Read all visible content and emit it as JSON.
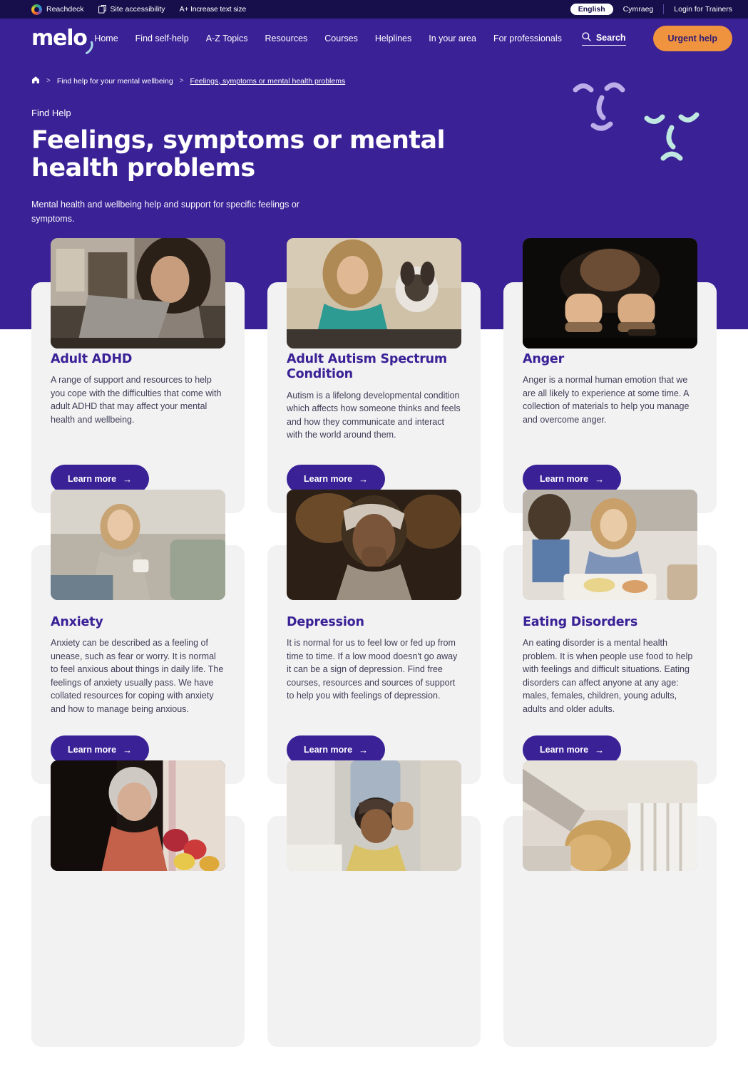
{
  "utility_bar": {
    "reachdeck_label": "Reachdeck",
    "site_accessibility_label": "Site accessibility",
    "increase_text_label": "A+ Increase text size",
    "lang_active": "English",
    "lang_alt": "Cymraeg",
    "login_label": "Login for Trainers",
    "background_color": "#160F4B"
  },
  "navbar": {
    "logo_text": "melo",
    "links": [
      {
        "label": "Home"
      },
      {
        "label": "Find self-help"
      },
      {
        "label": "A-Z Topics"
      },
      {
        "label": "Resources"
      },
      {
        "label": "Courses"
      },
      {
        "label": "Helplines"
      },
      {
        "label": "In your area"
      },
      {
        "label": "For professionals"
      }
    ],
    "search_label": "Search",
    "urgent_help_label": "Urgent help",
    "background_color": "#3A2196",
    "urgent_color": "#F0933F"
  },
  "breadcrumb": {
    "home_title": "Home",
    "items": [
      {
        "label": "Find help for your mental wellbeing",
        "current": false
      },
      {
        "label": "Feelings, symptoms or mental health problems",
        "current": true
      }
    ],
    "separator": ">"
  },
  "hero": {
    "eyebrow": "Find Help",
    "title": "Feelings, symptoms or mental health problems",
    "subtitle": "Mental health and wellbeing help and support for specific feelings or symptoms.",
    "face_colors": {
      "smiling": "#BCAEE8",
      "frowning": "#BFE8E0"
    }
  },
  "cards": [
    {
      "title": "Adult ADHD",
      "description": "A range of support and resources to help you cope with the difficulties that come with adult ADHD that may affect your mental health and wellbeing.",
      "button_label": "Learn more",
      "image_alt": "Woman with curly hair looking stressed at a laptop in a library"
    },
    {
      "title": "Adult Autism Spectrum Condition",
      "description": "Autism is a lifelong developmental condition which affects how someone thinks and feels and how they communicate and interact with the world around them.",
      "button_label": "Learn more",
      "image_alt": "Woman at a desk holding her head with a small dog beside her"
    },
    {
      "title": "Anger",
      "description": "Anger is a normal human emotion that we are all likely to experience at some time. A collection of materials to help you manage and overcome anger.",
      "button_label": "Learn more",
      "image_alt": "Two clenched fists against a dark background"
    },
    {
      "title": "Anxiety",
      "description": "Anxiety can be described as a feeling of unease, such as fear or worry. It is normal to feel anxious about things in daily life. The feelings of anxiety usually pass. We have collated resources for coping with anxiety and how to manage being anxious.",
      "button_label": "Learn more",
      "image_alt": "Woman with glasses sitting on a sofa holding a mug"
    },
    {
      "title": "Depression",
      "description": "It is normal for us to feel low or fed up from time to time. If a low mood doesn't go away it can be a sign of depression. Find free courses, resources and sources of support to help you with feelings of depression.",
      "button_label": "Learn more",
      "image_alt": "Woman in a head wrap looking pensive in a dim room"
    },
    {
      "title": "Eating Disorders",
      "description": "An eating disorder is a mental health problem. It is when people use food to help with feelings and difficult situations. Eating disorders can affect anyone at any age: males, females, children, young adults, adults and older adults.",
      "button_label": "Learn more",
      "image_alt": "Woman at a dinner table holding her head with family around her"
    },
    {
      "title": "",
      "description": "",
      "button_label": "",
      "image_alt": "Older woman sitting by a window with red and yellow flowers"
    },
    {
      "title": "",
      "description": "",
      "button_label": "",
      "image_alt": "Man sitting on a bed holding his head with a person beside him"
    },
    {
      "title": "",
      "description": "",
      "button_label": "",
      "image_alt": "Person with blonde hair lying down on a bed"
    }
  ]
}
